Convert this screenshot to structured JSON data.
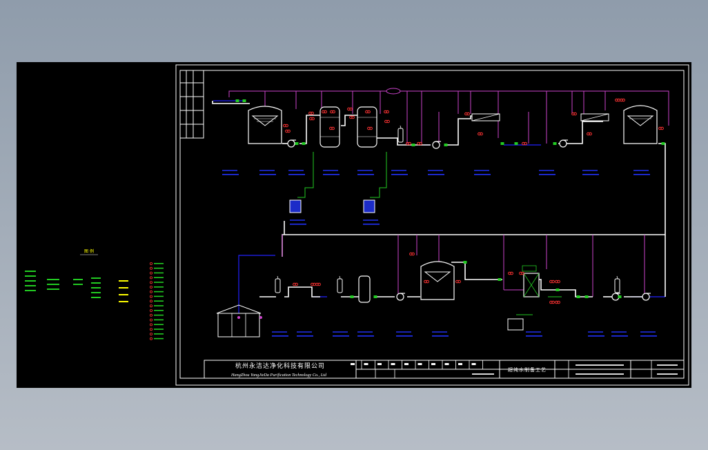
{
  "window": {
    "background_top": "#8f9cab",
    "background_bottom": "#b6bdc6",
    "viewport_color": "#000000"
  },
  "colors": {
    "frame": "#ffffff",
    "signal_line": "#cc44cc",
    "water_line": "#2222ff",
    "pipe": "#ffffff",
    "valve": "#ff3333",
    "instrument": "#22cc22",
    "dosing_line": "#22cc22",
    "legend_text": "#22cc22",
    "label_bars": "#2233ff",
    "accent": "#ffff00"
  },
  "title_block": {
    "company_cn": "杭州永洁达净化科技有限公司",
    "company_en": "HangZhou YongJieDa Purification Technology Co., Ltd",
    "drawing_title_cn": "超纯水制备工艺"
  },
  "legend": {
    "heading": "图 例"
  },
  "icons": {
    "tank": "storage-tank-icon",
    "pump": "centrifugal-pump-icon",
    "filter": "filter-vessel-icon",
    "ro_module": "reverse-osmosis-membrane-icon",
    "cartridge": "cartridge-filter-icon",
    "dosing": "dosing-tank-icon",
    "building": "building-icon",
    "valve": "valve-icon"
  }
}
